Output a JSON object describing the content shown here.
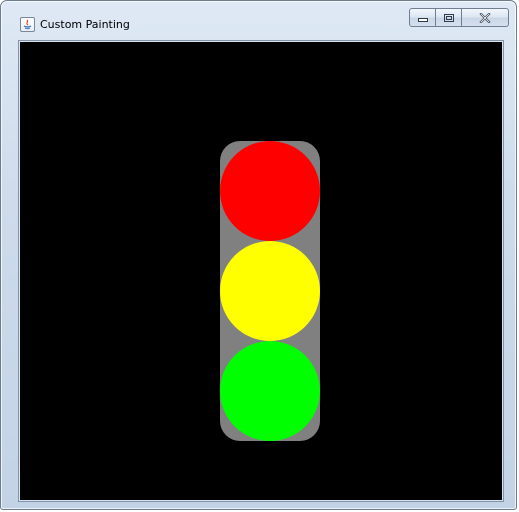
{
  "window": {
    "title": "Custom Painting",
    "app_icon": "java-icon",
    "controls": {
      "minimize_icon": "minimize-icon",
      "maximize_icon": "maximize-icon",
      "close_icon": "close-icon"
    }
  },
  "canvas": {
    "background": "#000000",
    "traffic_light": {
      "housing_color": "#808080",
      "lamps": [
        {
          "name": "red",
          "color": "#ff0000"
        },
        {
          "name": "yellow",
          "color": "#ffff00"
        },
        {
          "name": "green",
          "color": "#00ff00"
        }
      ]
    }
  }
}
